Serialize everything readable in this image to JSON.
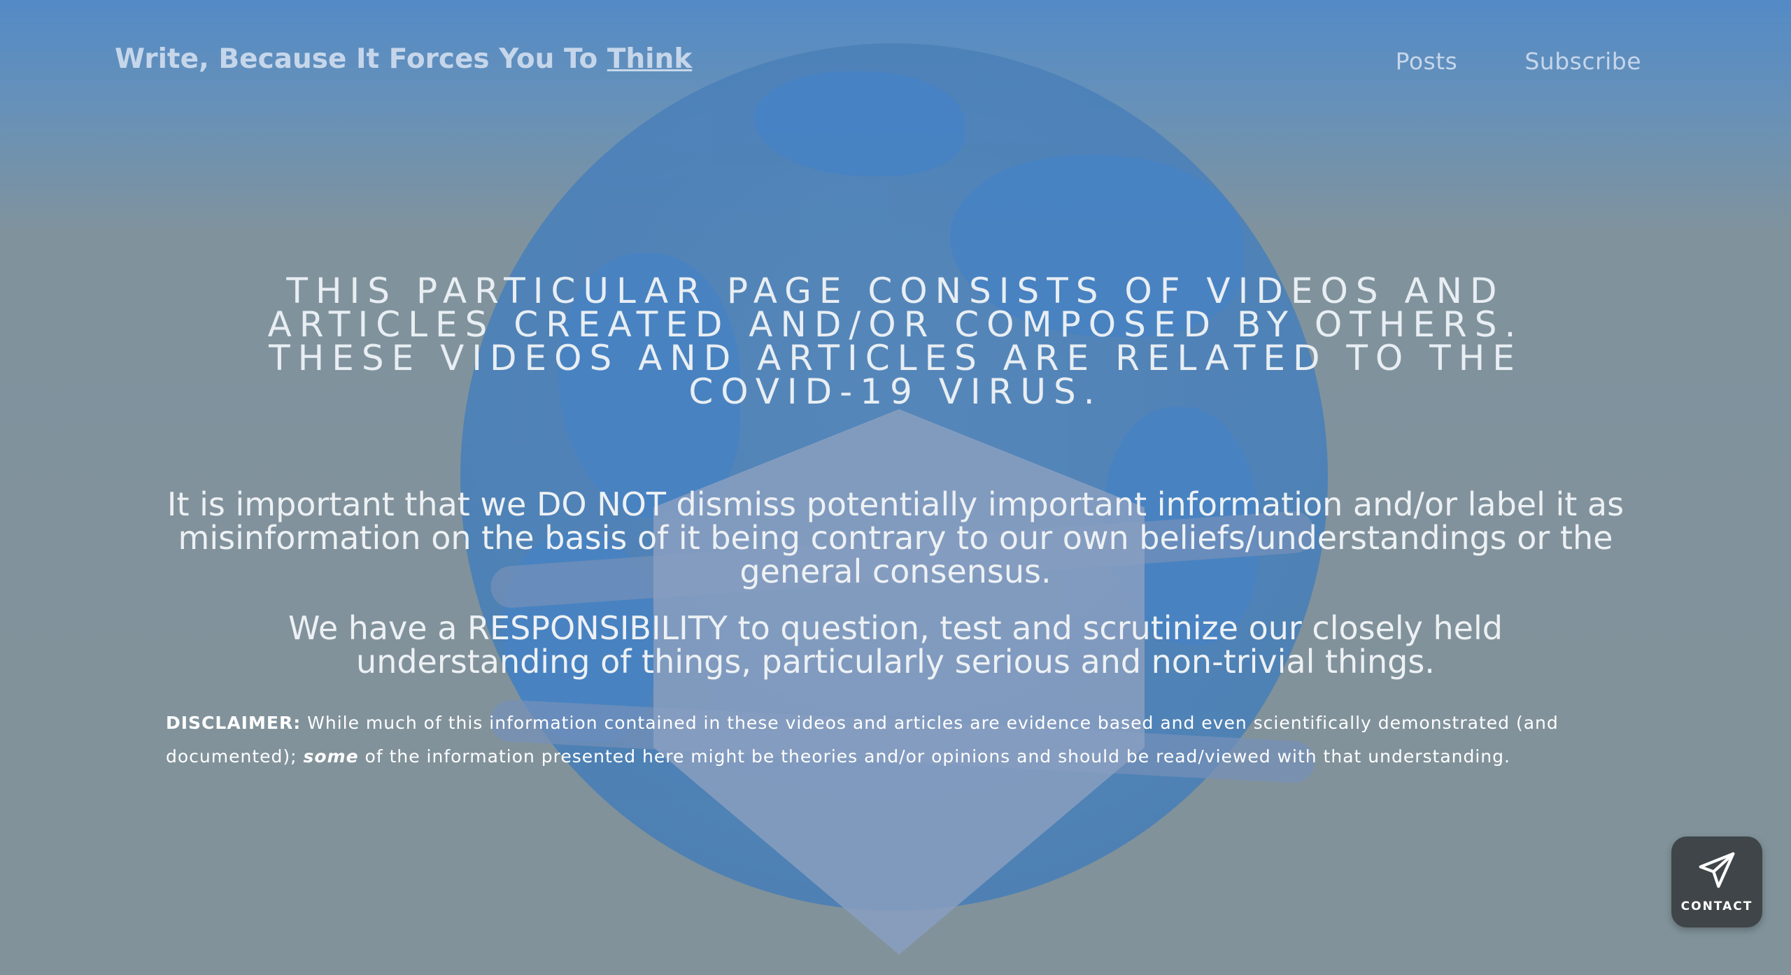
{
  "header": {
    "title_prefix": "Write, Because It Forces You To ",
    "title_link": "Think",
    "nav": [
      {
        "label": "Posts"
      },
      {
        "label": "Subscribe"
      }
    ]
  },
  "main": {
    "headline": "This particular page consists of videos and articles created and/or composed by others. These videos and articles are related to the COVID-19 virus.",
    "para1": {
      "pre": "It is important that we ",
      "emphasis": "DO NOT",
      "post": " dismiss potentially important information and/or label it as misinformation on the basis of it being contrary to our own beliefs/understandings or the general consensus."
    },
    "para2": {
      "pre": "We have a ",
      "emphasis": "RESPONSIBILITY",
      "post": " to question, test and scrutinize our closely held understanding of things, particularly serious and non-trivial things."
    },
    "disclaimer": {
      "label": "DISCLAIMER:",
      "text1": " While much of this information contained in these videos and articles are evidence based and even scientifically demonstrated (and documented); ",
      "some": "some",
      "text2": " of the information presented here might be theories and/or opinions and should be read/viewed with that understanding."
    }
  },
  "contact": {
    "label": "CONTACT",
    "icon": "paper-plane-icon"
  },
  "colors": {
    "header_text": "#c6d6ea",
    "contact_bg": "#3f4548",
    "globe_blue": "#3479c2"
  }
}
